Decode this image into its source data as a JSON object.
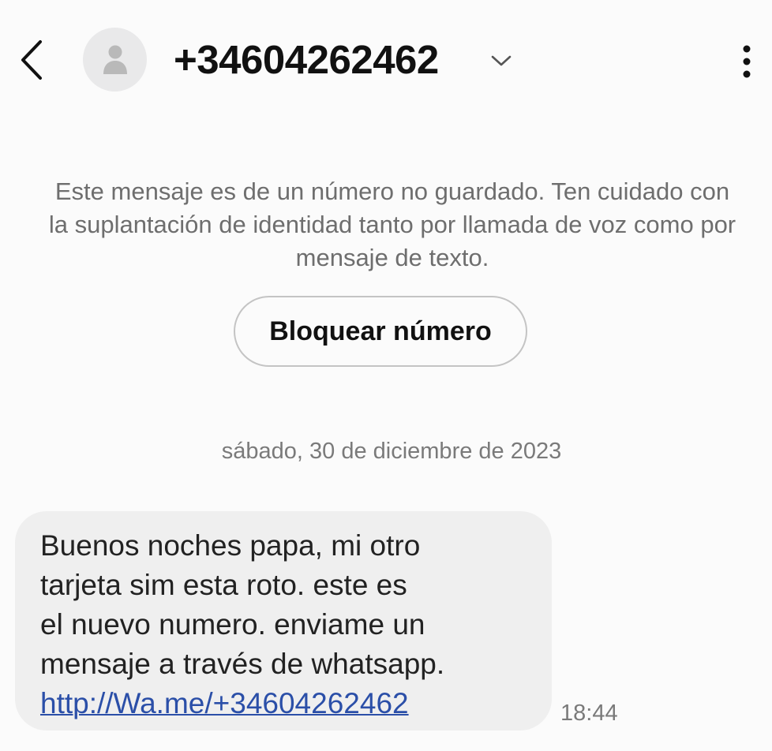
{
  "header": {
    "title": "+34604262462",
    "back_icon": "chevron-left-icon",
    "avatar_icon": "person-icon",
    "expand_icon": "chevron-down-icon",
    "menu_icon": "more-vertical-icon"
  },
  "warning": {
    "text": "Este mensaje es de un número no guardado. Ten cuidado con la suplantación de identidad tanto por llamada de voz como por mensaje de texto.",
    "block_button_label": "Bloquear número"
  },
  "conversation": {
    "date_separator": "sábado, 30 de diciembre de 2023",
    "messages": [
      {
        "direction": "incoming",
        "text": "Buenos noches  papa, mi otro\ntarjeta sim esta roto. este es\nel nuevo numero. enviame un\nmensaje a través de whatsapp.",
        "link": "http://Wa.me/+34604262462",
        "time": "18:44"
      }
    ]
  },
  "colors": {
    "background": "#fbfbfb",
    "bubble": "#efefef",
    "link": "#2b4fa8",
    "muted_text": "#6e6e6e"
  }
}
